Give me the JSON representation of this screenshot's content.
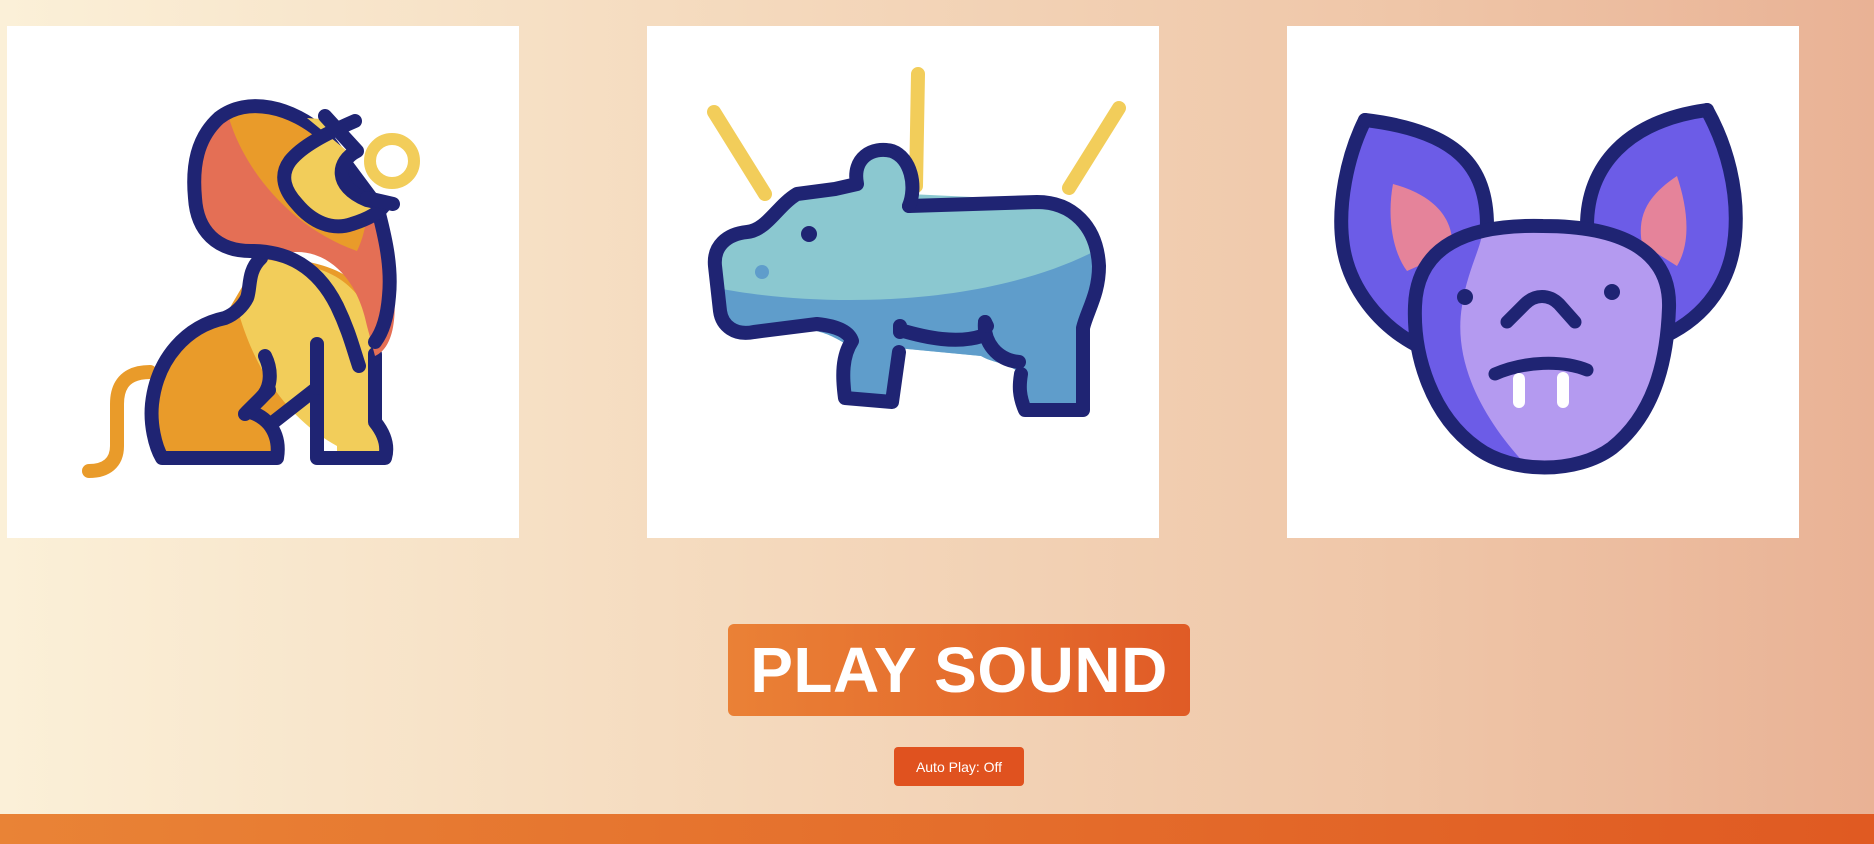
{
  "cards": [
    {
      "animal": "lion",
      "icon": "lion-icon"
    },
    {
      "animal": "hippo",
      "icon": "hippo-icon"
    },
    {
      "animal": "bat",
      "icon": "bat-icon"
    }
  ],
  "controls": {
    "play_label": "PLAY SOUND",
    "autoplay_label": "Auto Play: Off"
  },
  "colors": {
    "outline": "#1f2473",
    "accent": "#e05b26",
    "accent_light": "#ea8136",
    "lion_orange": "#e99b2a",
    "lion_yellow": "#f2cd5a",
    "lion_red": "#e46f55",
    "hippo_light": "#8bc8d0",
    "hippo_dark": "#5f9dcb",
    "bat_dark": "#6c5ce7",
    "bat_light": "#b49af0",
    "bat_ear_inner": "#e5839a"
  }
}
